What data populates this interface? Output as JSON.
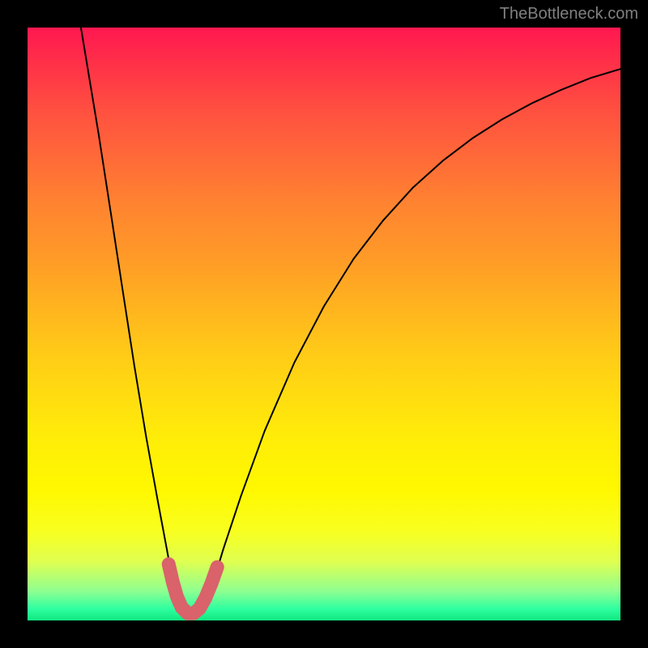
{
  "watermark": "TheBottleneck.com",
  "chart_data": {
    "type": "line",
    "title": "",
    "xlabel": "",
    "ylabel": "",
    "x_range": [
      0,
      1
    ],
    "y_range_normalized_percent": [
      0,
      100
    ],
    "series": [
      {
        "name": "curve",
        "description": "V-shaped bottleneck curve; y is percent of plot height from bottom (0=green baseline, 100=top red)",
        "points": [
          {
            "x": 0.09,
            "y": 100.0
          },
          {
            "x": 0.1,
            "y": 94.0
          },
          {
            "x": 0.12,
            "y": 82.0
          },
          {
            "x": 0.14,
            "y": 69.0
          },
          {
            "x": 0.16,
            "y": 56.0
          },
          {
            "x": 0.18,
            "y": 43.0
          },
          {
            "x": 0.2,
            "y": 31.0
          },
          {
            "x": 0.22,
            "y": 20.0
          },
          {
            "x": 0.235,
            "y": 12.0
          },
          {
            "x": 0.245,
            "y": 6.5
          },
          {
            "x": 0.258,
            "y": 2.5
          },
          {
            "x": 0.27,
            "y": 0.8
          },
          {
            "x": 0.285,
            "y": 0.8
          },
          {
            "x": 0.3,
            "y": 2.8
          },
          {
            "x": 0.315,
            "y": 7.0
          },
          {
            "x": 0.33,
            "y": 12.0
          },
          {
            "x": 0.36,
            "y": 21.0
          },
          {
            "x": 0.4,
            "y": 32.0
          },
          {
            "x": 0.45,
            "y": 43.5
          },
          {
            "x": 0.5,
            "y": 53.0
          },
          {
            "x": 0.55,
            "y": 61.0
          },
          {
            "x": 0.6,
            "y": 67.5
          },
          {
            "x": 0.65,
            "y": 73.0
          },
          {
            "x": 0.7,
            "y": 77.5
          },
          {
            "x": 0.75,
            "y": 81.3
          },
          {
            "x": 0.8,
            "y": 84.5
          },
          {
            "x": 0.85,
            "y": 87.2
          },
          {
            "x": 0.9,
            "y": 89.5
          },
          {
            "x": 0.95,
            "y": 91.5
          },
          {
            "x": 1.0,
            "y": 93.0
          }
        ]
      },
      {
        "name": "highlight",
        "description": "Thick red-pink segment marking the minimum region",
        "points": [
          {
            "x": 0.238,
            "y": 9.5
          },
          {
            "x": 0.245,
            "y": 6.5
          },
          {
            "x": 0.252,
            "y": 4.0
          },
          {
            "x": 0.26,
            "y": 2.2
          },
          {
            "x": 0.27,
            "y": 1.2
          },
          {
            "x": 0.28,
            "y": 1.2
          },
          {
            "x": 0.29,
            "y": 2.0
          },
          {
            "x": 0.3,
            "y": 3.8
          },
          {
            "x": 0.31,
            "y": 6.2
          },
          {
            "x": 0.32,
            "y": 9.0
          }
        ]
      }
    ],
    "colors": {
      "curve_stroke": "#000000",
      "highlight_stroke": "#d9626b",
      "background_top": "#ff1750",
      "background_bottom": "#10e880",
      "frame": "#000000"
    }
  }
}
